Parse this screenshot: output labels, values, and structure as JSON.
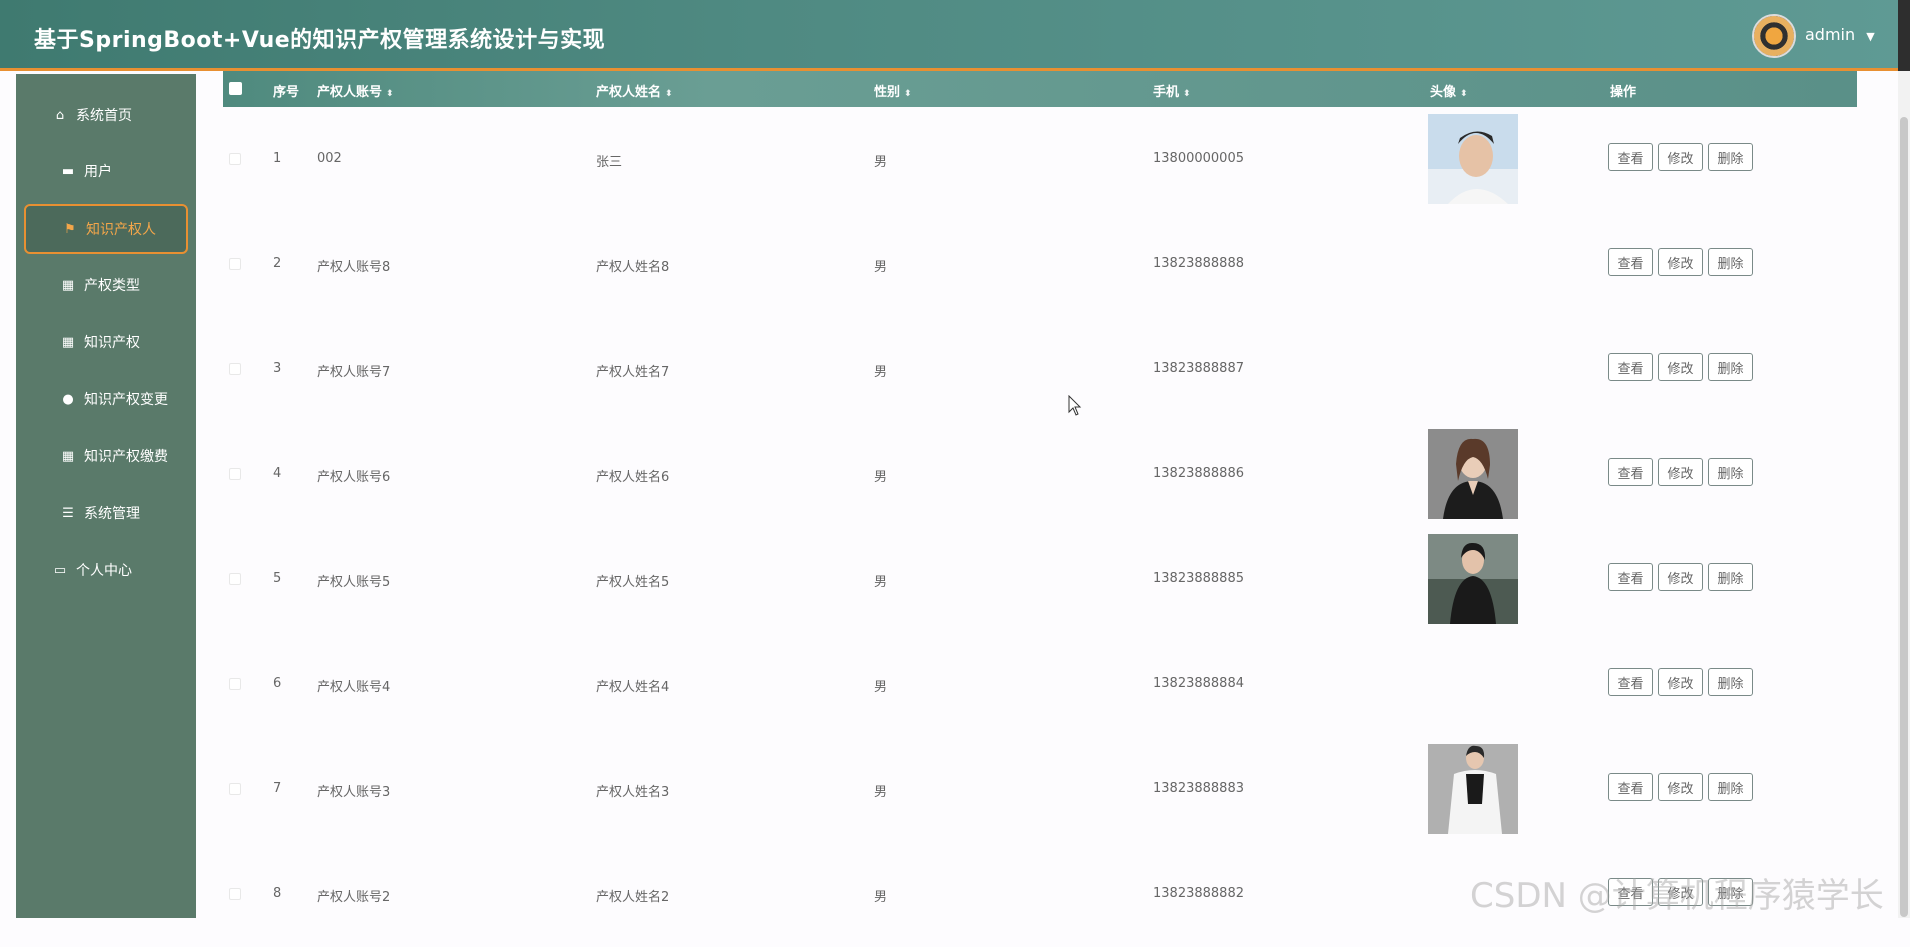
{
  "header": {
    "title": "基于SpringBoot+Vue的知识产权管理系统设计与实现",
    "username": "admin",
    "caret": "▼"
  },
  "sidebar": {
    "items": [
      {
        "label": "系统首页",
        "icon": "home-icon",
        "glyph": "⌂"
      },
      {
        "label": "用户",
        "icon": "chat-icon",
        "glyph": "▬"
      },
      {
        "label": "知识产权人",
        "icon": "flag-icon",
        "glyph": "⚑",
        "active": true
      },
      {
        "label": "产权类型",
        "icon": "grid-icon",
        "glyph": "▦"
      },
      {
        "label": "知识产权",
        "icon": "grid-icon",
        "glyph": "▦"
      },
      {
        "label": "知识产权变更",
        "icon": "pin-icon",
        "glyph": "●"
      },
      {
        "label": "知识产权缴费",
        "icon": "grid-icon",
        "glyph": "▦"
      },
      {
        "label": "系统管理",
        "icon": "list-icon",
        "glyph": "☰"
      },
      {
        "label": "个人中心",
        "icon": "card-icon",
        "glyph": "▭"
      }
    ]
  },
  "table": {
    "headers": {
      "index": "序号",
      "account": "产权人账号",
      "name": "产权人姓名",
      "gender": "性别",
      "phone": "手机",
      "avatar": "头像",
      "actions": "操作"
    },
    "sort_glyph": "⬍",
    "buttons": {
      "view": "查看",
      "edit": "修改",
      "delete": "删除"
    },
    "rows": [
      {
        "index": "1",
        "account": "002",
        "name": "张三",
        "gender": "男",
        "phone": "13800000005",
        "avatar": "man-light"
      },
      {
        "index": "2",
        "account": "产权人账号8",
        "name": "产权人姓名8",
        "gender": "男",
        "phone": "13823888888",
        "avatar": ""
      },
      {
        "index": "3",
        "account": "产权人账号7",
        "name": "产权人姓名7",
        "gender": "男",
        "phone": "13823888887",
        "avatar": ""
      },
      {
        "index": "4",
        "account": "产权人账号6",
        "name": "产权人姓名6",
        "gender": "男",
        "phone": "13823888886",
        "avatar": "woman-dark"
      },
      {
        "index": "5",
        "account": "产权人账号5",
        "name": "产权人姓名5",
        "gender": "男",
        "phone": "13823888885",
        "avatar": "woman-outdoor"
      },
      {
        "index": "6",
        "account": "产权人账号4",
        "name": "产权人姓名4",
        "gender": "男",
        "phone": "13823888884",
        "avatar": ""
      },
      {
        "index": "7",
        "account": "产权人账号3",
        "name": "产权人姓名3",
        "gender": "男",
        "phone": "13823888883",
        "avatar": "woman-white"
      },
      {
        "index": "8",
        "account": "产权人账号2",
        "name": "产权人姓名2",
        "gender": "男",
        "phone": "13823888882",
        "avatar": ""
      }
    ]
  },
  "watermark": "CSDN @计算机程序猿学长",
  "colors": {
    "header": "#4f8a82",
    "sidebar": "#5a7a6a",
    "accent": "#e89032"
  }
}
